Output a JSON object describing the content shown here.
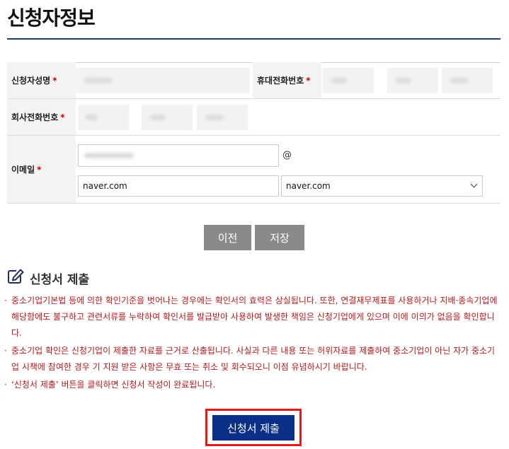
{
  "page": {
    "title": "신청자정보"
  },
  "form": {
    "applicant_name": {
      "label": "신청자성명",
      "required_mark": "*"
    },
    "mobile_phone": {
      "label": "휴대전화번호",
      "required_mark": "*"
    },
    "company_phone": {
      "label": "회사전화번호",
      "required_mark": "*"
    },
    "email": {
      "label": "이메일",
      "required_mark": "*",
      "at_sign": "@",
      "domain_value": "naver.com",
      "domain_select_value": "naver.com"
    }
  },
  "buttons": {
    "prev_label": "이전",
    "save_label": "저장",
    "submit_label": "신청서 제출"
  },
  "submission": {
    "title": "신청서 제출",
    "notes": [
      "중소기업기본법 등에 의한 확인기준을 벗어나는 경우에는 확인서의 효력은 상실됩니다. 또한, 연결재무제표를 사용하거나 지배·종속기업에 해당함에도 불구하고 관련서류를 누락하여 확인서를 발급받아 사용하여 발생한 책임은 신청기업에게 있으며 이에 이의가 없음을 확인합니다.",
      "중소기업 확인은 신청기업이 제출한 자료를 근거로 산출됩니다. 사실과 다른 내용 또는 허위자료를 제출하여 중소기업이 아닌 자가 중소기업 시책에 참여한 경우 기 지원 받은 사항은 무효 또는 취소 및 회수되오니 이점 유념하시기 바랍니다.",
      "‘신청서 제출’ 버튼을 클릭하면 신청서 작성이 완료됩니다."
    ]
  },
  "colors": {
    "accent_navy": "#0b2f86",
    "notice_red": "#b3181c",
    "highlight_red": "#e01b1b",
    "gray_button": "#8a8a8a"
  }
}
